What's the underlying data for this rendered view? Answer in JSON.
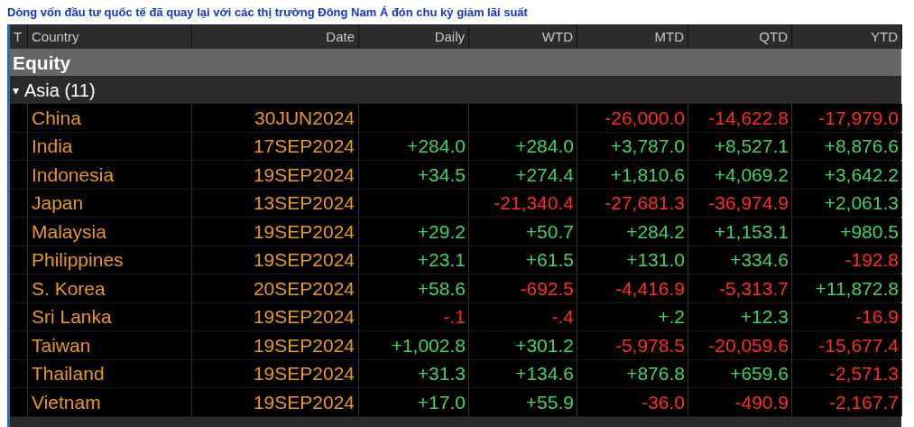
{
  "headline": "Dòng vốn đầu tư quốc tế đã quay lại với các thị trường Đông Nam Á đón chu kỳ giảm lãi suất",
  "table": {
    "columns": [
      "T",
      "Country",
      "Date",
      "Daily",
      "WTD",
      "MTD",
      "QTD",
      "YTD"
    ],
    "section": "Equity",
    "group": {
      "label": "Asia (11)",
      "expanded": true,
      "marker": "▾"
    },
    "rows": [
      {
        "country": "China",
        "date": "30JUN2024",
        "mtd": {
          "text": "-26,000.0",
          "color": "#ff2a2a"
        },
        "qtd": {
          "text": "-14,622.8",
          "color": "#ff2a2a"
        },
        "ytd": {
          "text": "-17,979.0",
          "color": "#ff2a2a"
        }
      },
      {
        "country": "India",
        "date": "17SEP2024",
        "daily": {
          "text": "+284.0",
          "color": "#3fd26a"
        },
        "wtd": {
          "text": "+284.0",
          "color": "#3fd26a"
        },
        "mtd": {
          "text": "+3,787.0",
          "color": "#3fd26a"
        },
        "qtd": {
          "text": "+8,527.1",
          "color": "#3fd26a"
        },
        "ytd": {
          "text": "+8,876.6",
          "color": "#3fd26a"
        }
      },
      {
        "country": "Indonesia",
        "date": "19SEP2024",
        "daily": {
          "text": "+34.5",
          "color": "#3fd26a"
        },
        "wtd": {
          "text": "+274.4",
          "color": "#3fd26a"
        },
        "mtd": {
          "text": "+1,810.6",
          "color": "#3fd26a"
        },
        "qtd": {
          "text": "+4,069.2",
          "color": "#3fd26a"
        },
        "ytd": {
          "text": "+3,642.2",
          "color": "#3fd26a"
        }
      },
      {
        "country": "Japan",
        "date": "13SEP2024",
        "wtd": {
          "text": "-21,340.4",
          "color": "#ff2a2a"
        },
        "mtd": {
          "text": "-27,681.3",
          "color": "#ff2a2a"
        },
        "qtd": {
          "text": "-36,974.9",
          "color": "#ff2a2a"
        },
        "ytd": {
          "text": "+2,061.3",
          "color": "#3fd26a"
        }
      },
      {
        "country": "Malaysia",
        "date": "19SEP2024",
        "daily": {
          "text": "+29.2",
          "color": "#3fd26a"
        },
        "wtd": {
          "text": "+50.7",
          "color": "#3fd26a"
        },
        "mtd": {
          "text": "+284.2",
          "color": "#3fd26a"
        },
        "qtd": {
          "text": "+1,153.1",
          "color": "#3fd26a"
        },
        "ytd": {
          "text": "+980.5",
          "color": "#3fd26a"
        }
      },
      {
        "country": "Philippines",
        "date": "19SEP2024",
        "daily": {
          "text": "+23.1",
          "color": "#3fd26a"
        },
        "wtd": {
          "text": "+61.5",
          "color": "#3fd26a"
        },
        "mtd": {
          "text": "+131.0",
          "color": "#3fd26a"
        },
        "qtd": {
          "text": "+334.6",
          "color": "#3fd26a"
        },
        "ytd": {
          "text": "-192.8",
          "color": "#ff2a2a"
        }
      },
      {
        "country": "S. Korea",
        "date": "20SEP2024",
        "daily": {
          "text": "+58.6",
          "color": "#3fd26a"
        },
        "wtd": {
          "text": "-692.5",
          "color": "#ff2a2a"
        },
        "mtd": {
          "text": "-4,416.9",
          "color": "#ff2a2a"
        },
        "qtd": {
          "text": "-5,313.7",
          "color": "#ff2a2a"
        },
        "ytd": {
          "text": "+11,872.8",
          "color": "#3fd26a"
        }
      },
      {
        "country": "Sri Lanka",
        "date": "19SEP2024",
        "daily": {
          "text": "-.1",
          "color": "#ff2a2a"
        },
        "wtd": {
          "text": "-.4",
          "color": "#ff2a2a"
        },
        "mtd": {
          "text": "+.2",
          "color": "#3fd26a"
        },
        "qtd": {
          "text": "+12.3",
          "color": "#3fd26a"
        },
        "ytd": {
          "text": "-16.9",
          "color": "#ff2a2a"
        }
      },
      {
        "country": "Taiwan",
        "date": "19SEP2024",
        "daily": {
          "text": "+1,002.8",
          "color": "#3fd26a"
        },
        "wtd": {
          "text": "+301.2",
          "color": "#3fd26a"
        },
        "mtd": {
          "text": "-5,978.5",
          "color": "#ff2a2a"
        },
        "qtd": {
          "text": "-20,059.6",
          "color": "#ff2a2a"
        },
        "ytd": {
          "text": "-15,677.4",
          "color": "#ff2a2a"
        }
      },
      {
        "country": "Thailand",
        "date": "19SEP2024",
        "daily": {
          "text": "+31.3",
          "color": "#3fd26a"
        },
        "wtd": {
          "text": "+134.6",
          "color": "#3fd26a"
        },
        "mtd": {
          "text": "+876.8",
          "color": "#3fd26a"
        },
        "qtd": {
          "text": "+659.6",
          "color": "#3fd26a"
        },
        "ytd": {
          "text": "-2,571.3",
          "color": "#ff2a2a"
        }
      },
      {
        "country": "Vietnam",
        "date": "19SEP2024",
        "daily": {
          "text": "+17.0",
          "color": "#3fd26a"
        },
        "wtd": {
          "text": "+55.9",
          "color": "#3fd26a"
        },
        "mtd": {
          "text": "-36.0",
          "color": "#ff2a2a"
        },
        "qtd": {
          "text": "-490.9",
          "color": "#ff2a2a"
        },
        "ytd": {
          "text": "-2,167.7",
          "color": "#ff2a2a"
        }
      }
    ]
  }
}
